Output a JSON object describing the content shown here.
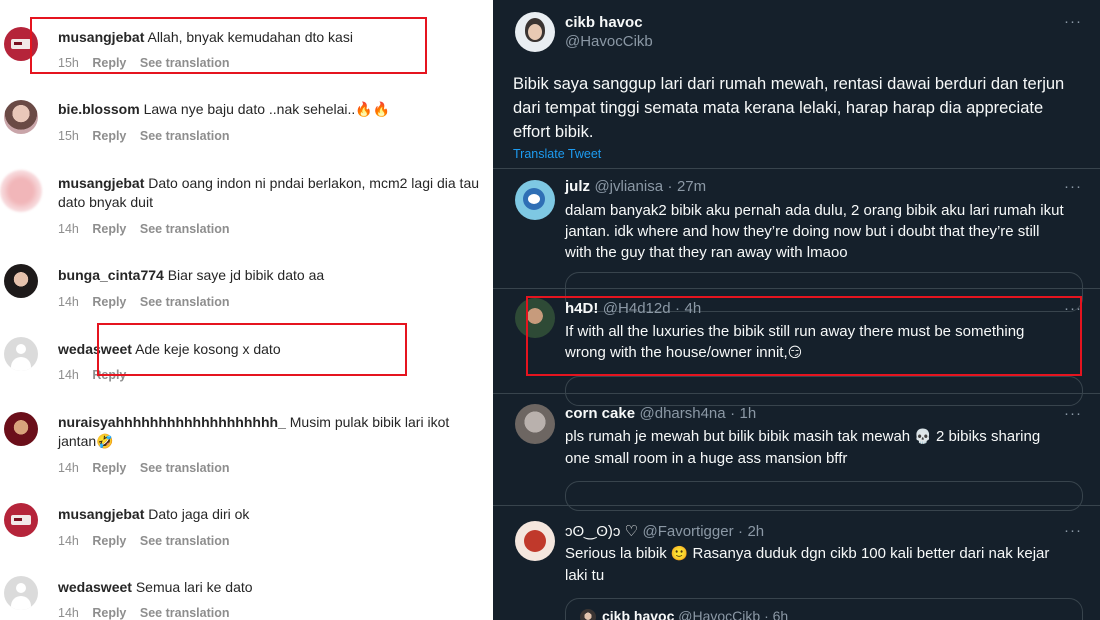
{
  "instagram": {
    "comments": [
      {
        "username": "musangjebat",
        "text": "Allah, bnyak kemudahan dto kasi",
        "time": "15h",
        "reply": "Reply",
        "translate": "See translation",
        "avatar": "red-logo-avatar"
      },
      {
        "username": "bie.blossom",
        "text": "Lawa nye baju dato ..nak sehelai..",
        "emoji": "🔥🔥",
        "time": "15h",
        "reply": "Reply",
        "translate": "See translation",
        "avatar": "girl-avatar"
      },
      {
        "username": "musangjebat",
        "text": "Dato oang indon ni pndai berlakon, mcm2 lagi dia tau dato bnyak duit",
        "time": "14h",
        "reply": "Reply",
        "translate": "See translation",
        "avatar": "blurred-avatar"
      },
      {
        "username": "bunga_cinta774",
        "text": "Biar saye jd bibik dato aa",
        "time": "14h",
        "reply": "Reply",
        "translate": "See translation",
        "avatar": "dark-hair-avatar"
      },
      {
        "username": "wedasweet",
        "text": "Ade keje kosong x dato",
        "time": "14h",
        "reply": "Reply",
        "translate": "",
        "avatar": "default-avatar"
      },
      {
        "username": "nuraisyahhhhhhhhhhhhhhhhhhh_",
        "text": "Musim pulak bibik lari ikot jantan",
        "emoji": "🤣",
        "time": "14h",
        "reply": "Reply",
        "translate": "See translation",
        "avatar": "red-portrait-avatar"
      },
      {
        "username": "musangjebat",
        "text": "Dato jaga diri ok",
        "time": "14h",
        "reply": "Reply",
        "translate": "See translation",
        "avatar": "red-logo-avatar"
      },
      {
        "username": "wedasweet",
        "text": "Semua lari ke dato",
        "time": "14h",
        "reply": "Reply",
        "translate": "See translation",
        "avatar": "default-avatar"
      }
    ]
  },
  "twitter": {
    "main": {
      "name": "cikb havoc",
      "handle": "@HavocCikb",
      "more": "···",
      "text": "Bibik saya sanggup lari dari rumah mewah, rentasi dawai berduri dan terjun dari tempat tinggi semata mata kerana lelaki, harap harap dia appreciate effort bibik.",
      "translate": "Translate Tweet"
    },
    "replies": [
      {
        "name": "julz",
        "handle": "@jvlianisa",
        "time": "27m",
        "more": "···",
        "text": "dalam banyak2 bibik aku pernah ada dulu, 2 orang bibik aku lari rumah ikut jantan. idk where and how they’re doing now but i doubt that they’re still with the guy that they ran away with lmaoo"
      },
      {
        "name": "h4D!",
        "handle": "@H4d12d",
        "time": "4h",
        "more": "···",
        "text": "If with all the luxuries the bibik still run away there must be something wrong with the house/owner innit,",
        "emoji": "😏"
      },
      {
        "name": "corn cake",
        "handle": "@dharsh4na",
        "time": "1h",
        "more": "···",
        "text": "pls rumah je mewah but bilik bibik masih tak mewah",
        "emoji": "💀",
        "text2": "2 bibiks sharing one small room in a huge ass mansion bffr"
      },
      {
        "name": "ɔʘ‿ʘ)ɔ ♡",
        "handle": "@Favortigger",
        "time": "2h",
        "more": "···",
        "text": "Serious la bibik",
        "emoji": "🙂",
        "text2": "Rasanya duduk dgn cikb 100 kali better dari nak kejar laki tu",
        "quote_name": "cikb havoc",
        "quote_handle": "@HavocCikb",
        "quote_time": "6h"
      }
    ],
    "sep": "·"
  }
}
